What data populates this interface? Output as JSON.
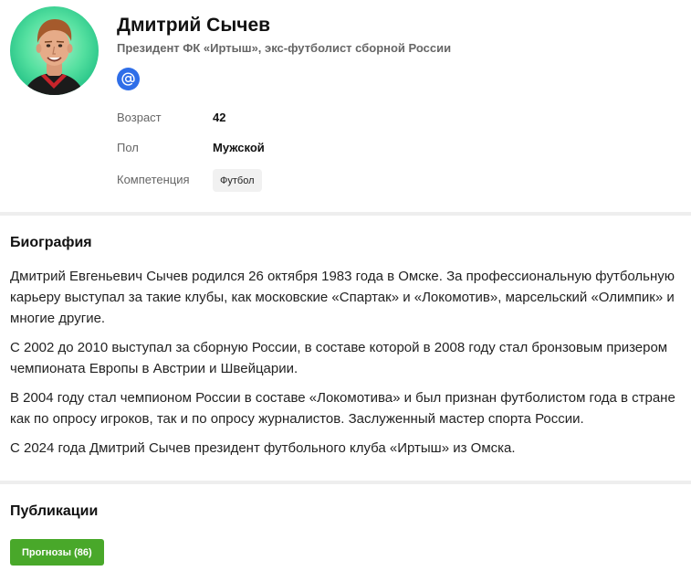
{
  "profile": {
    "name": "Дмитрий Сычев",
    "subtitle": "Президент ФК «Иртыш», экс-футболист сборной России",
    "email_icon": "at-sign-icon",
    "attributes": [
      {
        "label": "Возраст",
        "value": "42"
      },
      {
        "label": "Пол",
        "value": "Мужской"
      },
      {
        "label": "Компетенция",
        "value": "Футбол"
      }
    ]
  },
  "biography": {
    "title": "Биография",
    "paragraphs": [
      "Дмитрий Евгеньевич Сычев родился 26 октября 1983 года в Омске. За профессиональную футбольную карьеру выступал за такие клубы, как московские «Спартак» и «Локомотив», марсельский «Олимпик» и многие другие.",
      "С 2002 до 2010 выступал за сборную России, в составе которой в 2008 году стал бронзовым призером чемпионата Европы в Австрии и Швейцарии.",
      "В 2004 году стал чемпионом России в составе «Локомотива» и был признан футболистом года в стране как по опросу игроков, так и по опросу журналистов. Заслуженный мастер спорта России.",
      "С 2024 года Дмитрий Сычев президент футбольного клуба «Иртыш» из Омска."
    ]
  },
  "publications": {
    "title": "Публикации",
    "button_label": "Прогнозы (86)"
  },
  "colors": {
    "accent_blue": "#2f6ee8",
    "button_green": "#49a82a",
    "avatar_bg": "#3fd493"
  }
}
